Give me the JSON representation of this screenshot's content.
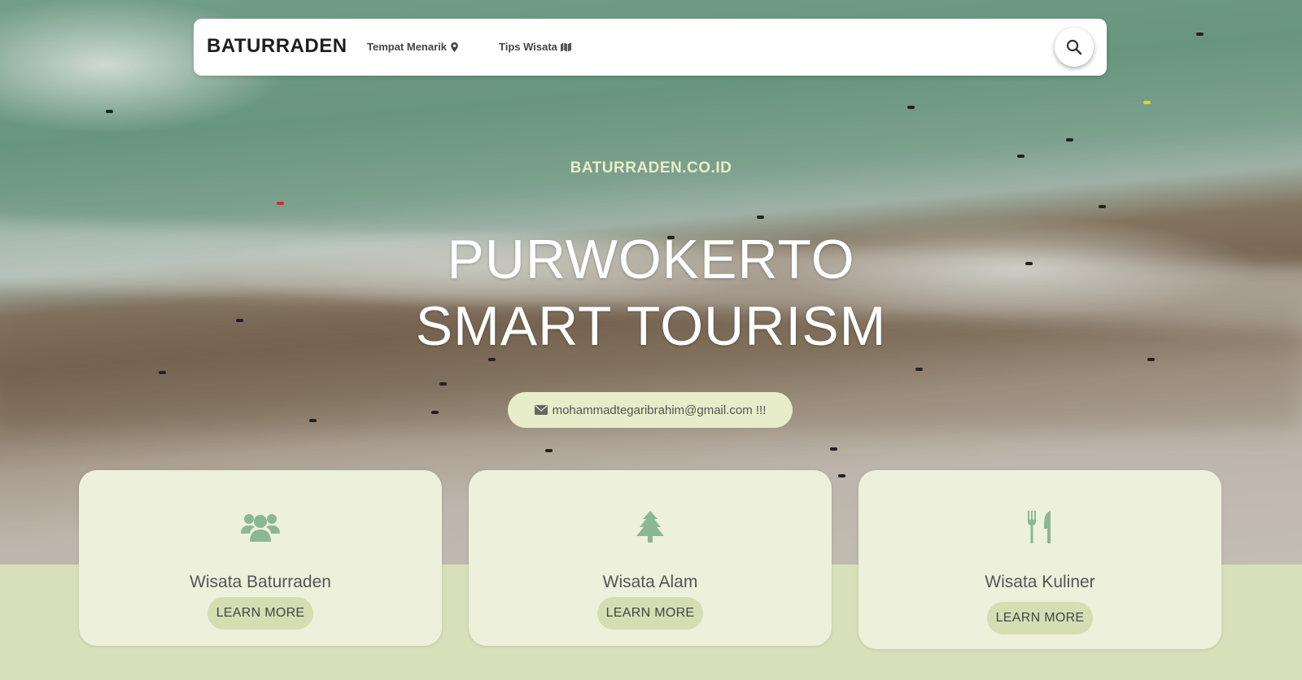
{
  "navbar": {
    "brand": "BATURRADEN",
    "links": [
      {
        "label": "Tempat Menarik",
        "icon": "map-marker-icon"
      },
      {
        "label": "Tips Wisata",
        "icon": "map-icon"
      }
    ],
    "search_icon": "search-icon"
  },
  "hero": {
    "tagline": "BATURRADEN.CO.ID",
    "headline_line1": "PURWOKERTO",
    "headline_line2": "SMART TOURISM",
    "email": "mohammadtegaribrahim@gmail.com !!!",
    "email_icon": "envelope-icon"
  },
  "cards": [
    {
      "title": "Wisata Baturraden",
      "button": "LEARN MORE",
      "icon": "users-icon"
    },
    {
      "title": "Wisata Alam",
      "button": "LEARN MORE",
      "icon": "tree-icon"
    },
    {
      "title": "Wisata Kuliner",
      "button": "LEARN MORE",
      "icon": "utensils-icon"
    }
  ],
  "colors": {
    "accent_green": "#8bb795",
    "card_bg": "#edf0da",
    "button_bg": "#d5ddb3",
    "page_bg": "#d8e0bb",
    "tagline": "#e8edc6"
  }
}
